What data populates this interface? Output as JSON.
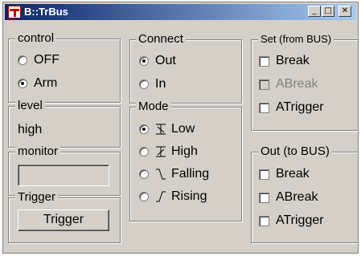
{
  "window": {
    "title": "B::TrBus",
    "buttons": {
      "minimize": "_",
      "maximize": "□",
      "close": "✕"
    }
  },
  "control": {
    "legend": "control",
    "options": [
      {
        "label": "OFF",
        "checked": false
      },
      {
        "label": "Arm",
        "checked": true
      }
    ]
  },
  "level": {
    "legend": "level",
    "value": "high"
  },
  "monitor": {
    "legend": "monitor",
    "value": ""
  },
  "trigger": {
    "legend": "Trigger",
    "button_label": "Trigger"
  },
  "connect": {
    "legend": "Connect",
    "options": [
      {
        "label": "Out",
        "checked": true
      },
      {
        "label": "In",
        "checked": false
      }
    ]
  },
  "mode": {
    "legend": "Mode",
    "options": [
      {
        "label": "Low",
        "checked": true,
        "icon": "low-level-icon"
      },
      {
        "label": "High",
        "checked": false,
        "icon": "high-level-icon"
      },
      {
        "label": "Falling",
        "checked": false,
        "icon": "falling-edge-icon"
      },
      {
        "label": "Rising",
        "checked": false,
        "icon": "rising-edge-icon"
      }
    ]
  },
  "set_from_bus": {
    "legend": "Set (from BUS)",
    "items": [
      {
        "label": "Break",
        "checked": false,
        "enabled": true
      },
      {
        "label": "ABreak",
        "checked": false,
        "enabled": false
      },
      {
        "label": "ATrigger",
        "checked": false,
        "enabled": true
      }
    ]
  },
  "out_to_bus": {
    "legend": "Out (to BUS)",
    "items": [
      {
        "label": "Break",
        "checked": false,
        "enabled": true
      },
      {
        "label": "ABreak",
        "checked": false,
        "enabled": true
      },
      {
        "label": "ATrigger",
        "checked": false,
        "enabled": true
      }
    ]
  }
}
